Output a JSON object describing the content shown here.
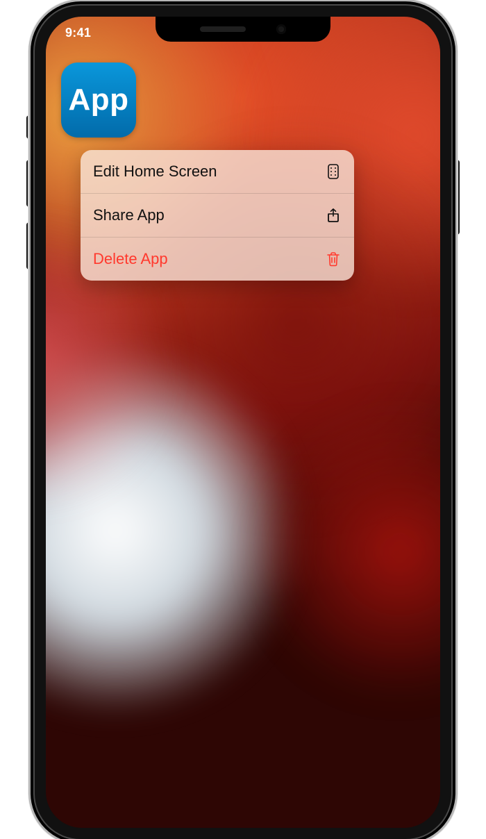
{
  "status": {
    "time": "9:41"
  },
  "app": {
    "icon_label": "App"
  },
  "menu": {
    "items": [
      {
        "label": "Edit Home Screen",
        "icon": "apps-grid-icon",
        "destructive": false
      },
      {
        "label": "Share App",
        "icon": "share-icon",
        "destructive": false
      },
      {
        "label": "Delete App",
        "icon": "trash-icon",
        "destructive": true
      }
    ]
  },
  "colors": {
    "destructive": "#ff3b30",
    "app_icon_top": "#0f96d7",
    "app_icon_bottom": "#066aa6"
  }
}
